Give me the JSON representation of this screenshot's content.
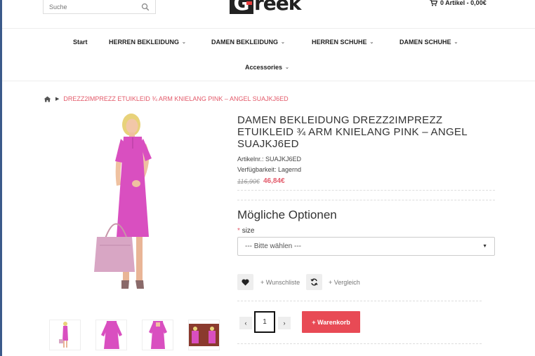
{
  "search": {
    "placeholder": "Suche"
  },
  "logo": {
    "first_letter": "G",
    "rest": "reek"
  },
  "cart": {
    "label": "0 Artikel - 0,00€"
  },
  "nav": [
    {
      "label": "Start",
      "has_caret": false
    },
    {
      "label": "HERREN BEKLEIDUNG",
      "has_caret": true
    },
    {
      "label": "DAMEN BEKLEIDUNG",
      "has_caret": true
    },
    {
      "label": "HERREN SCHUHE",
      "has_caret": true
    },
    {
      "label": "DAMEN SCHUHE",
      "has_caret": true
    },
    {
      "label": "Accessories",
      "has_caret": true
    }
  ],
  "breadcrumb": {
    "current": "DREZZ2IMPREZZ ETUIKLEID ¾ ARM KNIELANG PINK – ANGEL SUAJKJ6ED"
  },
  "product": {
    "title": "DAMEN BEKLEIDUNG DREZZ2IMPREZZ ETUIKLEID ¾ ARM KNIELANG PINK – ANGEL SUAJKJ6ED",
    "sku": "Artikelnr.: SUAJKJ6ED",
    "availability": "Verfügbarkeit: Lagernd",
    "price_old": "116,90€",
    "price_new": "46,84€"
  },
  "options": {
    "heading": "Mögliche Optionen",
    "size_star": "*",
    "size_label": "size",
    "size_selected": "--- Bitte wählen ---"
  },
  "actions": {
    "wishlist": "+ Wunschliste",
    "compare": "+ Vergleich",
    "quantity": "1",
    "qty_minus": "‹",
    "qty_plus": "›",
    "add_to_cart": "+ Warenkorb"
  },
  "colors": {
    "accent": "#e84a55",
    "link": "#e35a6a",
    "dress": "#d94fc0"
  }
}
